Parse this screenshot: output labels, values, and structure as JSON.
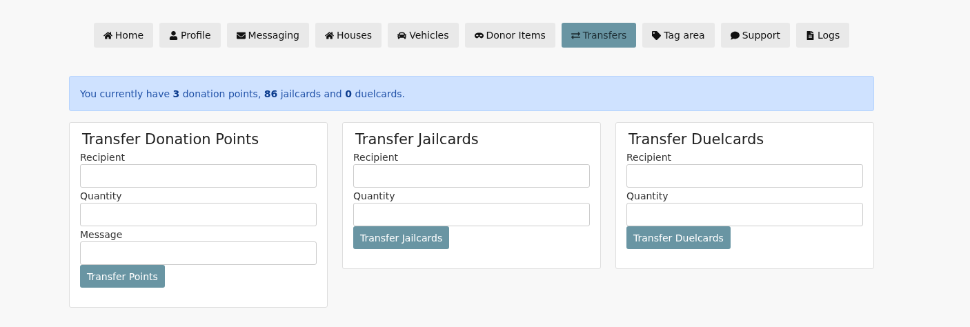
{
  "nav": [
    {
      "label": "Home",
      "selected": false
    },
    {
      "label": "Profile",
      "selected": false
    },
    {
      "label": "Messaging",
      "selected": false
    },
    {
      "label": "Houses",
      "selected": false
    },
    {
      "label": "Vehicles",
      "selected": false
    },
    {
      "label": "Donor Items",
      "selected": false
    },
    {
      "label": "Transfers",
      "selected": true
    },
    {
      "label": "Tag area",
      "selected": false
    },
    {
      "label": "Support",
      "selected": false
    },
    {
      "label": "Logs",
      "selected": false
    }
  ],
  "alert": "You currently have **3** donation points, **86** jailcards and **0** duelcards.",
  "cards": [
    {
      "title": "Transfer Donation Points",
      "fields": [
        "Recipient",
        "Quantity",
        "Message"
      ],
      "button": "Transfer Points"
    },
    {
      "title": "Transfer Jailcards",
      "fields": [
        "Recipient",
        "Quantity"
      ],
      "button": "Transfer Jailcards"
    },
    {
      "title": "Transfer Duelcards",
      "fields": [
        "Recipient",
        "Quantity"
      ],
      "button": "Transfer Duelcards"
    }
  ]
}
